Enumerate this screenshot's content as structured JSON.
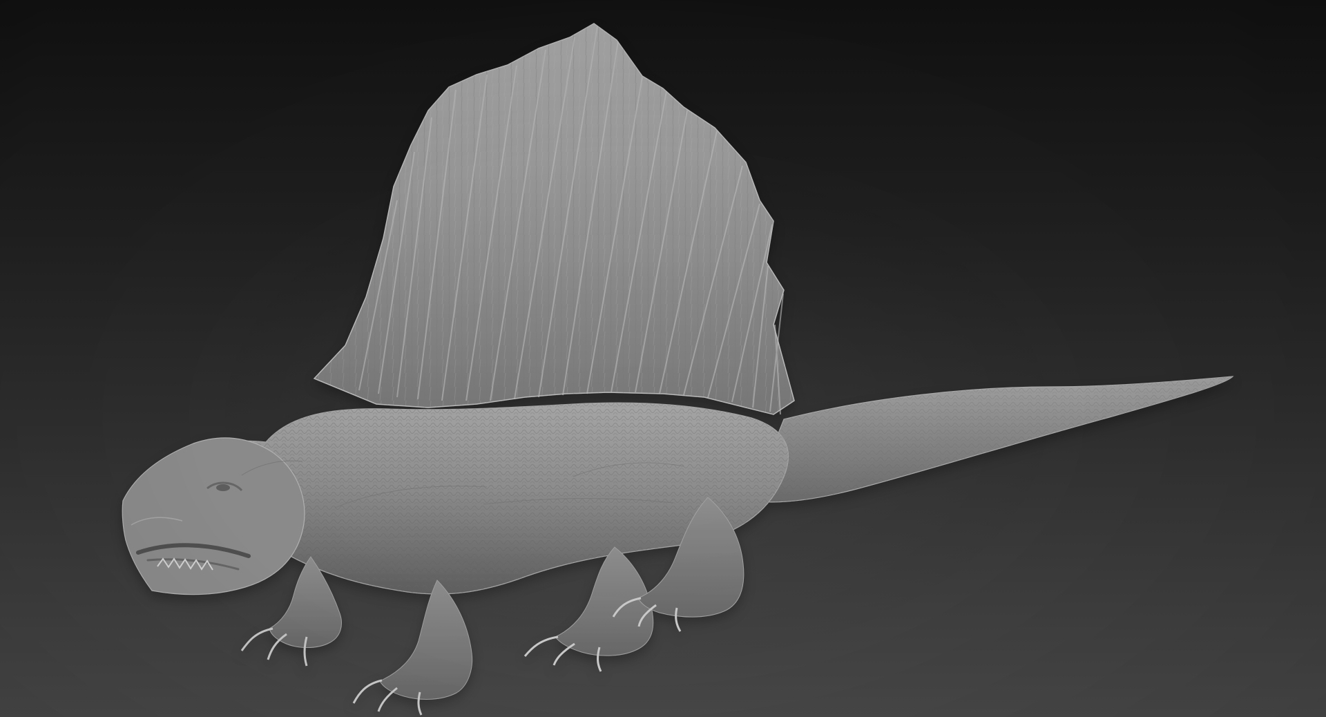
{
  "viewport": {
    "background_top": "#121212",
    "background_bottom": "#474747"
  },
  "model": {
    "subject": "dimetrodon-sculpt",
    "material_color": "#8f8f8f",
    "shadow_color": "#4a4a4a",
    "highlight_color": "#c2c2c2"
  }
}
